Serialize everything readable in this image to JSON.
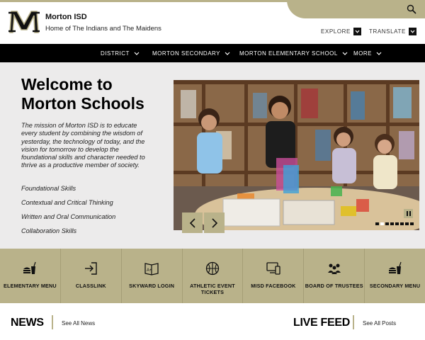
{
  "header": {
    "school_name": "Morton ISD",
    "tagline": "Home of The Indians and The Maidens",
    "explore": "EXPLORE",
    "translate": "TRANSLATE"
  },
  "nav": {
    "items": [
      {
        "label": "DISTRICT"
      },
      {
        "label": "MORTON SECONDARY"
      },
      {
        "label": "MORTON ELEMENTARY SCHOOL"
      },
      {
        "label": "MORE"
      }
    ]
  },
  "hero": {
    "title": "Welcome to Morton Schools",
    "mission": "The mission of Morton ISD is to educate every student by combining the wisdom of yesterday, the technology of today, and the vision for tomorrow to develop the foundational skills and character needed to thrive as a productive member of society.",
    "skills": [
      "Foundational Skills",
      "Contextual and Critical Thinking",
      "Written and Oral Communication",
      "Collaboration Skills"
    ]
  },
  "quicklinks": [
    {
      "label": "ELEMENTARY MENU",
      "icon": "food-drink-icon"
    },
    {
      "label": "CLASSLINK",
      "icon": "login-arrow-icon"
    },
    {
      "label": "SKYWARD LOGIN",
      "icon": "gradebook-icon"
    },
    {
      "label": "ATHLETIC EVENT TICKETS",
      "icon": "basketball-icon"
    },
    {
      "label": "MISD FACEBOOK",
      "icon": "devices-icon"
    },
    {
      "label": "BOARD OF TRUSTEES",
      "icon": "people-icon"
    },
    {
      "label": "SECONDARY MENU",
      "icon": "food-drink-icon"
    }
  ],
  "bottom": {
    "news_title": "NEWS",
    "news_link": "See All News",
    "feed_title": "LIVE FEED",
    "feed_link": "See All Posts"
  },
  "colors": {
    "accent": "#b9b28a",
    "nav_bg": "#000000",
    "hero_bg": "#ecebeb"
  }
}
